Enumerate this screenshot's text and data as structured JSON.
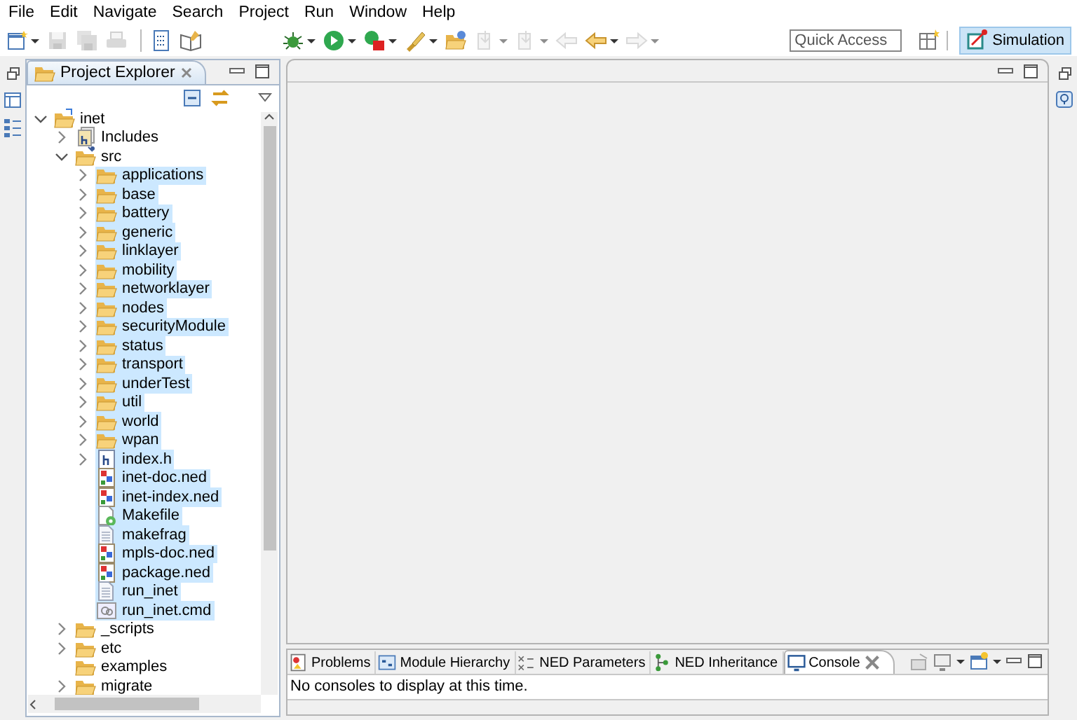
{
  "menu": [
    "File",
    "Edit",
    "Navigate",
    "Search",
    "Project",
    "Run",
    "Window",
    "Help"
  ],
  "toolbar": [
    {
      "kind": "new",
      "dropdown": true,
      "disabled": false
    },
    {
      "kind": "save",
      "dropdown": false,
      "disabled": true
    },
    {
      "kind": "saveall",
      "dropdown": false,
      "disabled": true
    },
    {
      "kind": "print",
      "dropdown": false,
      "disabled": true
    },
    {
      "kind": "sep"
    },
    {
      "kind": "binary",
      "dropdown": false,
      "disabled": false
    },
    {
      "kind": "book",
      "dropdown": false,
      "disabled": false
    },
    {
      "kind": "gap"
    },
    {
      "kind": "bug",
      "dropdown": true,
      "disabled": false
    },
    {
      "kind": "run",
      "dropdown": true,
      "disabled": false
    },
    {
      "kind": "record",
      "dropdown": true,
      "disabled": false
    },
    {
      "kind": "brush",
      "dropdown": true,
      "disabled": false
    },
    {
      "kind": "folder",
      "dropdown": false,
      "disabled": false
    },
    {
      "kind": "step",
      "dropdown": true,
      "disabled": true
    },
    {
      "kind": "step",
      "dropdown": true,
      "disabled": true
    },
    {
      "kind": "backedit",
      "dropdown": false,
      "disabled": true
    },
    {
      "kind": "back",
      "dropdown": true,
      "disabled": false
    },
    {
      "kind": "forward",
      "dropdown": true,
      "disabled": true
    }
  ],
  "quick_access": {
    "placeholder": "Quick Access"
  },
  "perspective": {
    "label": "Simulation",
    "selected": true
  },
  "explorer": {
    "title": "Project Explorer",
    "items": [
      {
        "label": "inet",
        "kind": "project",
        "expanded": true,
        "selected": false,
        "children": [
          {
            "label": "Includes",
            "kind": "includes",
            "expanded": false,
            "selected": false
          },
          {
            "label": "src",
            "kind": "srcfolder",
            "expanded": true,
            "selected": false,
            "children": [
              {
                "label": "applications",
                "kind": "folder",
                "expanded": false,
                "selected": true
              },
              {
                "label": "base",
                "kind": "folder",
                "expanded": false,
                "selected": true
              },
              {
                "label": "battery",
                "kind": "folder",
                "expanded": false,
                "selected": true
              },
              {
                "label": "generic",
                "kind": "folder",
                "expanded": false,
                "selected": true
              },
              {
                "label": "linklayer",
                "kind": "folder",
                "expanded": false,
                "selected": true
              },
              {
                "label": "mobility",
                "kind": "folder",
                "expanded": false,
                "selected": true
              },
              {
                "label": "networklayer",
                "kind": "folder",
                "expanded": false,
                "selected": true
              },
              {
                "label": "nodes",
                "kind": "folder",
                "expanded": false,
                "selected": true
              },
              {
                "label": "securityModule",
                "kind": "folder",
                "expanded": false,
                "selected": true
              },
              {
                "label": "status",
                "kind": "folder",
                "expanded": false,
                "selected": true
              },
              {
                "label": "transport",
                "kind": "folder",
                "expanded": false,
                "selected": true
              },
              {
                "label": "underTest",
                "kind": "folder",
                "expanded": false,
                "selected": true
              },
              {
                "label": "util",
                "kind": "folder",
                "expanded": false,
                "selected": true
              },
              {
                "label": "world",
                "kind": "folder",
                "expanded": false,
                "selected": true
              },
              {
                "label": "wpan",
                "kind": "folder",
                "expanded": false,
                "selected": true
              },
              {
                "label": "index.h",
                "kind": "header",
                "expanded": false,
                "selected": true
              },
              {
                "label": "inet-doc.ned",
                "kind": "ned",
                "selected": true
              },
              {
                "label": "inet-index.ned",
                "kind": "ned",
                "selected": true
              },
              {
                "label": "Makefile",
                "kind": "makefile",
                "selected": true
              },
              {
                "label": "makefrag",
                "kind": "text",
                "selected": true
              },
              {
                "label": "mpls-doc.ned",
                "kind": "ned",
                "selected": true
              },
              {
                "label": "package.ned",
                "kind": "ned",
                "selected": true
              },
              {
                "label": "run_inet",
                "kind": "text",
                "selected": true
              },
              {
                "label": "run_inet.cmd",
                "kind": "cmd",
                "selected": true
              }
            ]
          },
          {
            "label": "_scripts",
            "kind": "folder",
            "expanded": false,
            "selected": false
          },
          {
            "label": "etc",
            "kind": "folder",
            "expanded": false,
            "selected": false
          },
          {
            "label": "examples",
            "kind": "folder",
            "selected": false
          },
          {
            "label": "migrate",
            "kind": "folder",
            "expanded": false,
            "selected": false
          }
        ]
      }
    ]
  },
  "bottom_tabs": [
    {
      "label": "Problems",
      "kind": "problems",
      "selected": false
    },
    {
      "label": "Module Hierarchy",
      "kind": "hierarchy",
      "selected": false
    },
    {
      "label": "NED Parameters",
      "kind": "params",
      "selected": false
    },
    {
      "label": "NED Inheritance",
      "kind": "inherit",
      "selected": false
    },
    {
      "label": "Console",
      "kind": "console",
      "selected": true
    }
  ],
  "console_message": "No consoles to display at this time."
}
